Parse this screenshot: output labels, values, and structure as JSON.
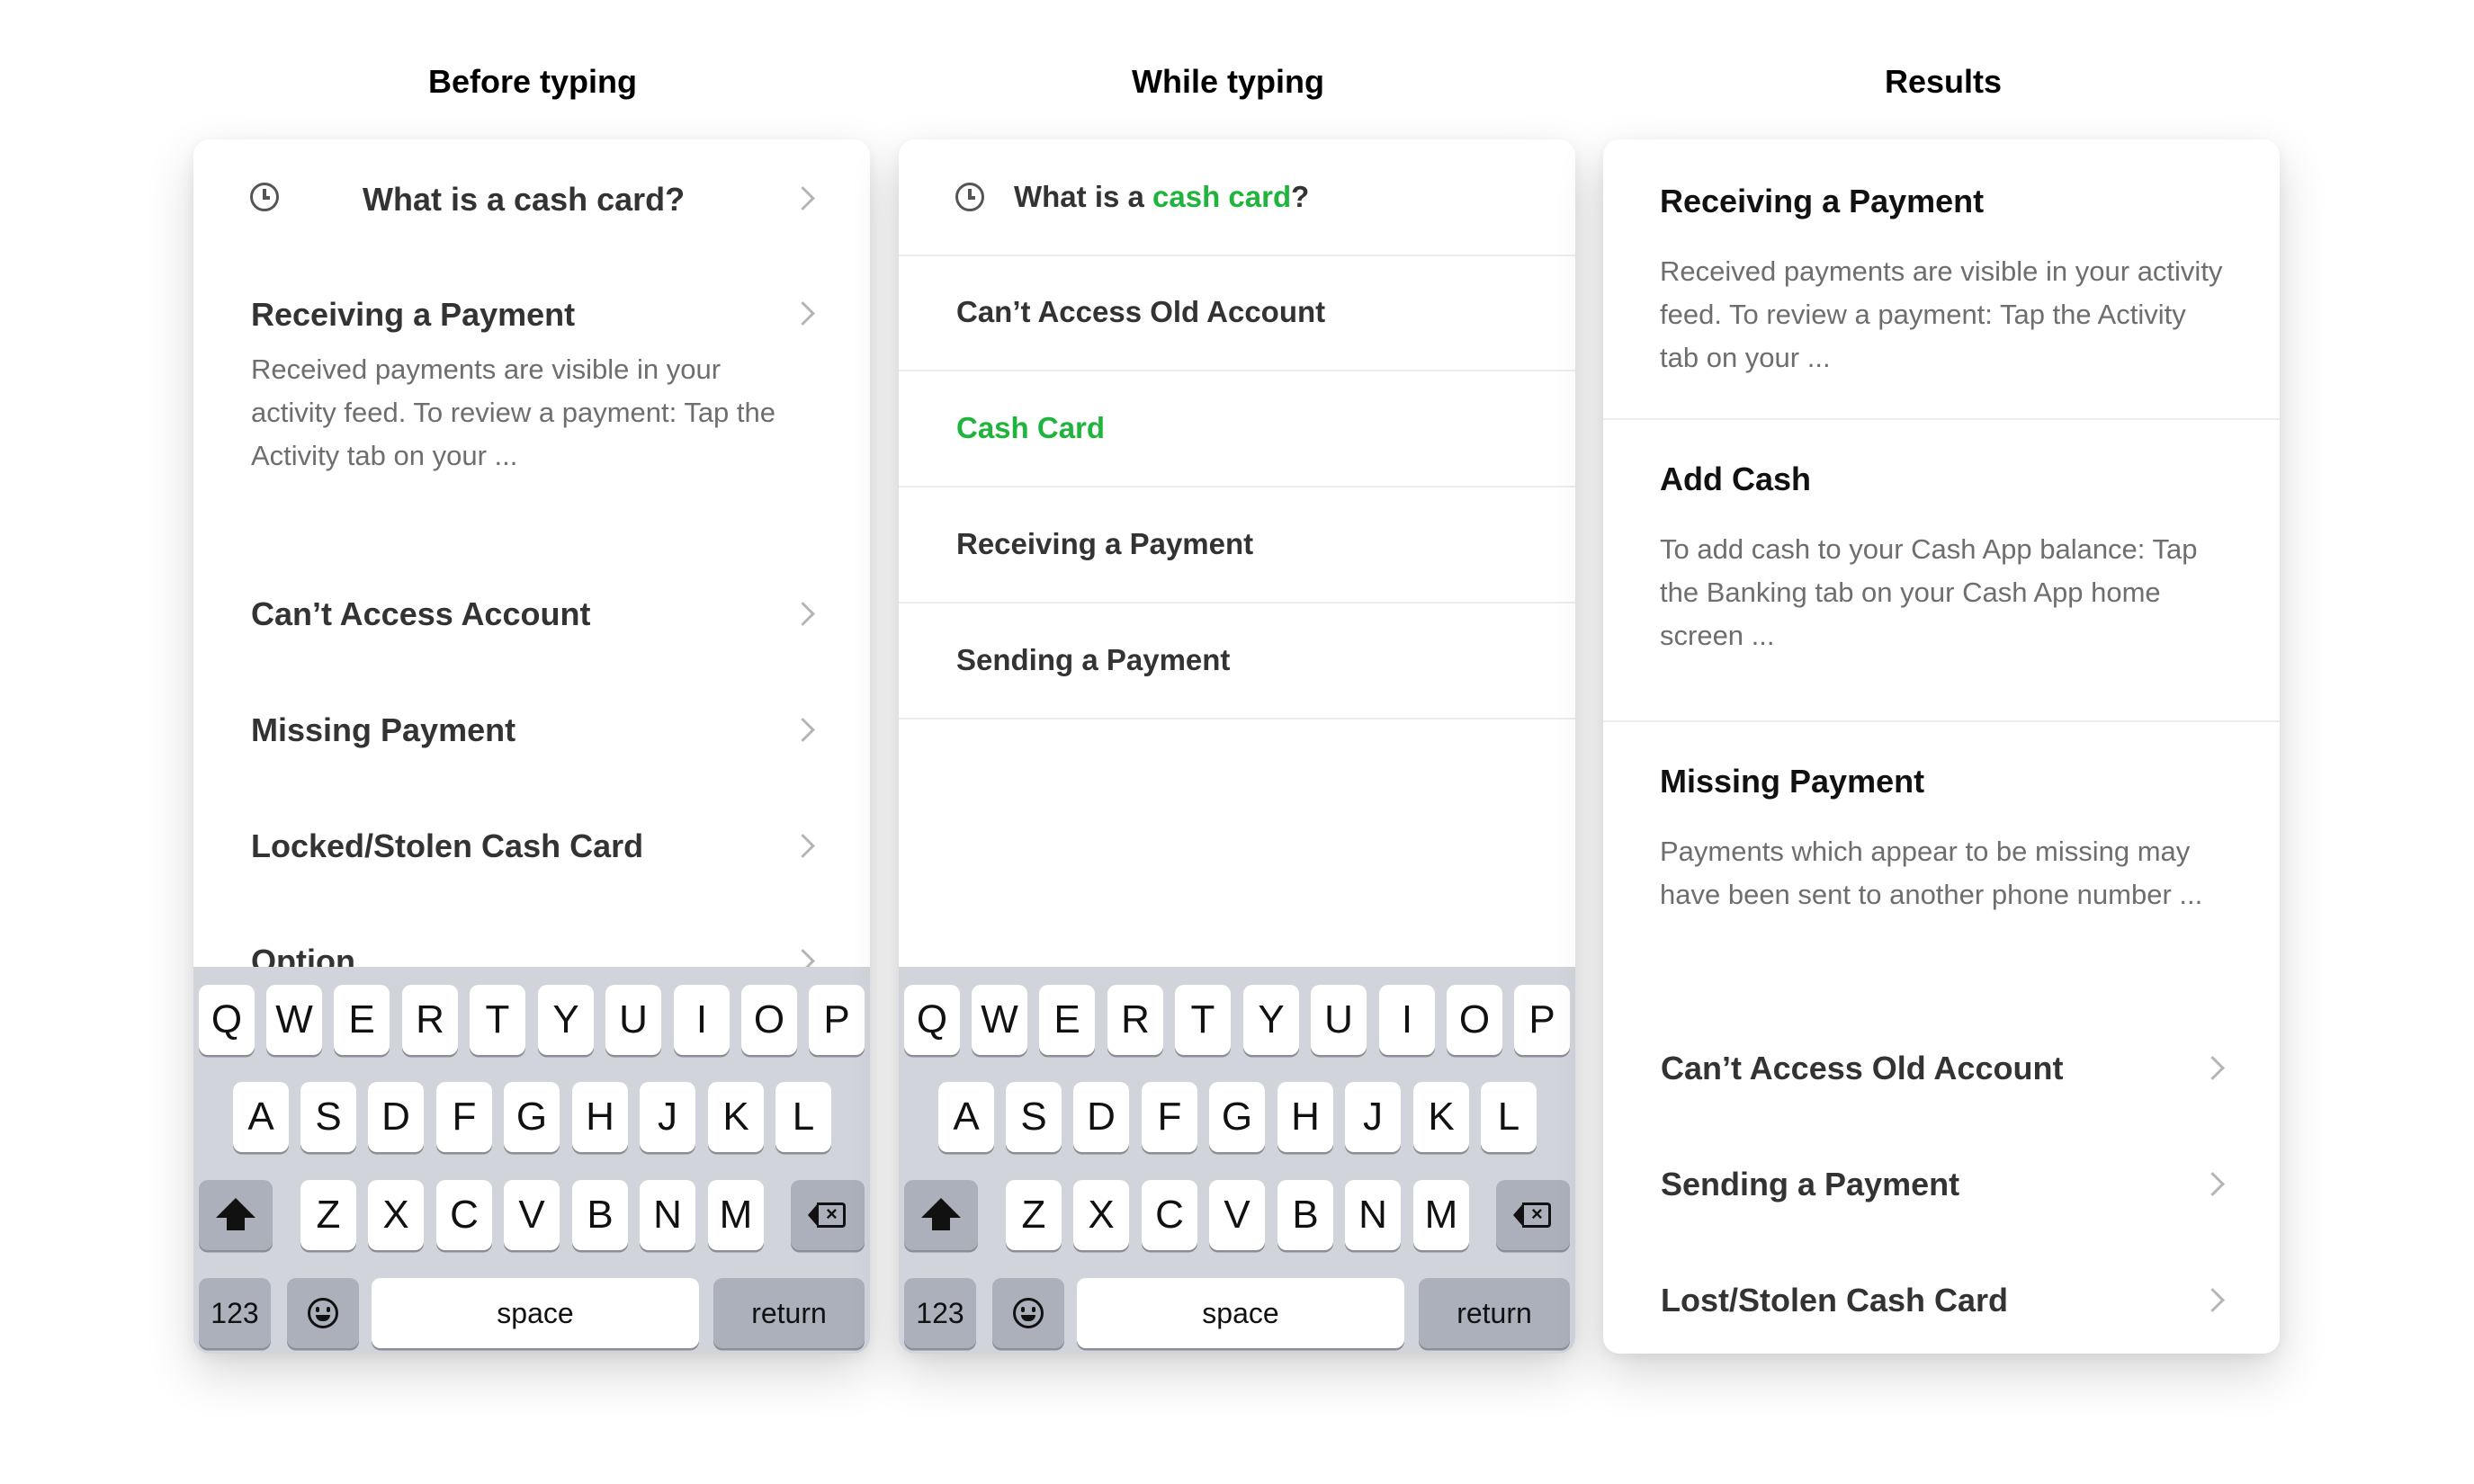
{
  "columns": {
    "before_title": "Before typing",
    "while_title": "While typing",
    "results_title": "Results"
  },
  "before": {
    "recent_search": "What is a cash card?",
    "featured": {
      "title": "Receiving a Payment",
      "description": "Received payments are visible in your activity feed. To review a payment: Tap the Activity tab on your ..."
    },
    "items": [
      "Can’t Access Account",
      "Missing Payment",
      "Locked/Stolen Cash Card",
      "Option"
    ]
  },
  "while": {
    "query_prefix": "What is a ",
    "query_highlight": "cash card",
    "query_suffix": "?",
    "suggestions": [
      "Can’t Access Old Account",
      "Cash Card",
      "Receiving a Payment",
      "Sending a Payment"
    ]
  },
  "results": {
    "articles": [
      {
        "title": "Receiving a Payment",
        "description": "Received payments are visible in your activity feed. To review a payment: Tap the Activity tab on your ..."
      },
      {
        "title": "Add Cash",
        "description": "To add cash to your Cash App balance: Tap the Banking tab on your Cash App home screen ..."
      },
      {
        "title": "Missing Payment",
        "description": "Payments which appear to be missing may have been sent to another phone number ..."
      }
    ],
    "links": [
      "Can’t Access Old Account",
      "Sending a Payment",
      "Lost/Stolen Cash Card"
    ]
  },
  "keyboard": {
    "row1": [
      "Q",
      "W",
      "E",
      "R",
      "T",
      "Y",
      "U",
      "I",
      "O",
      "P"
    ],
    "row2": [
      "A",
      "S",
      "D",
      "F",
      "G",
      "H",
      "J",
      "K",
      "L"
    ],
    "row3": [
      "Z",
      "X",
      "C",
      "V",
      "B",
      "N",
      "M"
    ],
    "numbers": "123",
    "space": "space",
    "return": "return"
  },
  "colors": {
    "accent_green": "#1fb43b",
    "keyboard_bg": "#d1d4da"
  }
}
